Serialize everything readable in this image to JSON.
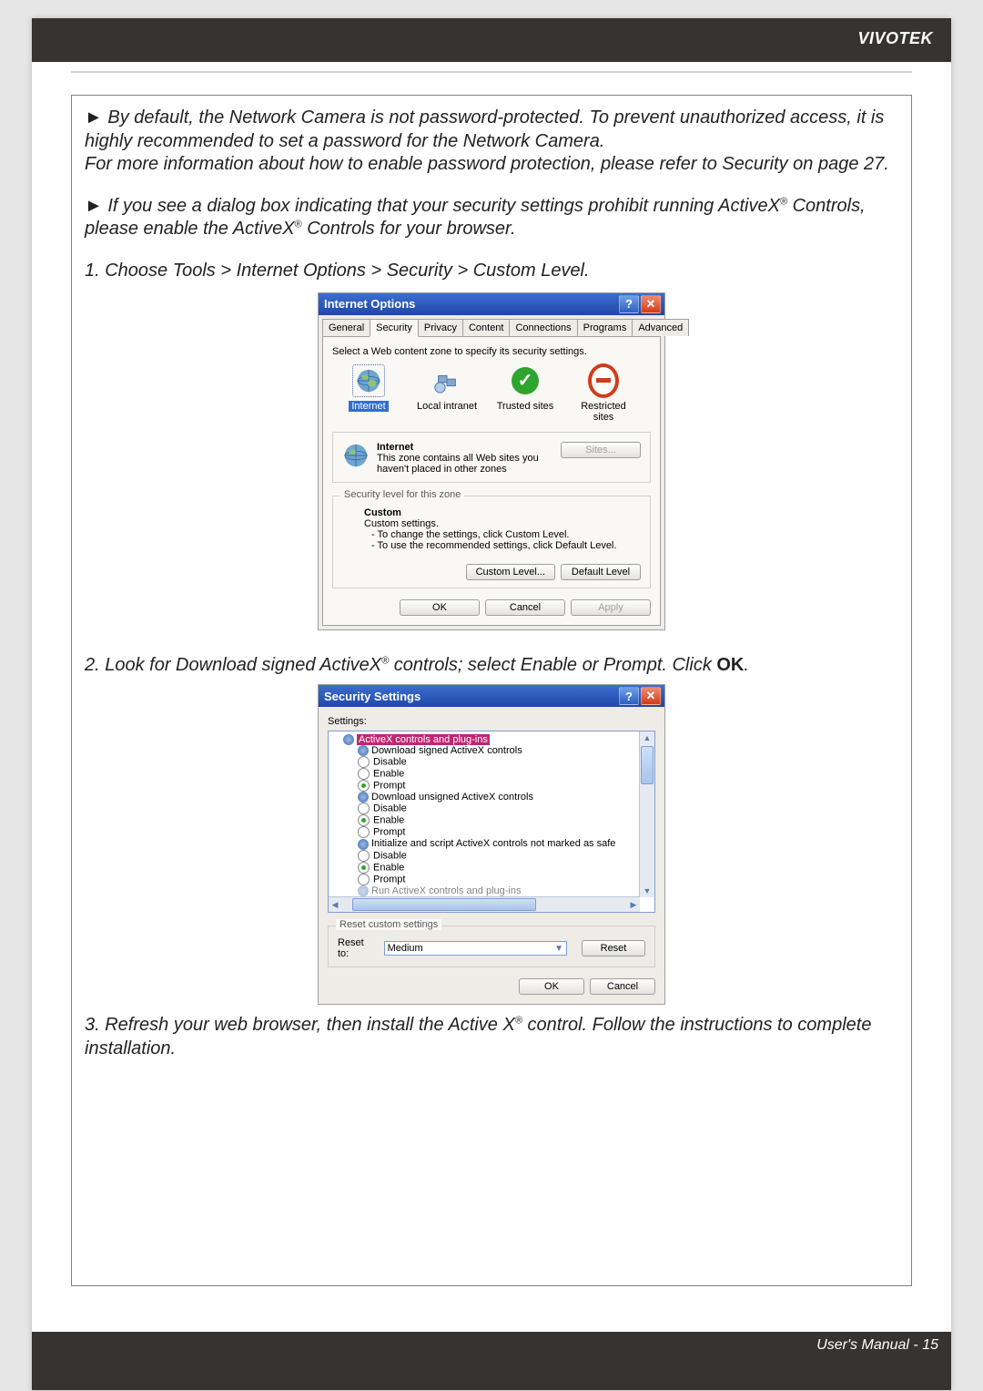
{
  "header": {
    "brand": "VIVOTEK"
  },
  "footer": {
    "text": "User's Manual - 15"
  },
  "paragraphs": {
    "p1a": "By default, the Network Camera is not password-protected. To prevent unauthorized access, it is highly recommended to set a password for the Network Camera.",
    "p1b": "For more information about how to enable password protection, please refer to Security on page 27.",
    "p2_pre": "If you see a dialog box indicating that your security settings prohibit running ActiveX",
    "p2_post": " Controls, please enable the ActiveX",
    "p2_end": " Controls for your browser.",
    "step1": "1. Choose Tools > Internet Options > Security > Custom Level.",
    "step2_pre": "2. Look for Download signed ActiveX",
    "step2_post": " controls; select Enable or Prompt. Click ",
    "step2_ok": "OK",
    "step2_end": ".",
    "step3_pre": "3. Refresh your web browser, then install the Active X",
    "step3_post": " control. Follow the instructions to complete installation."
  },
  "dialog_internet_options": {
    "title": "Internet Options",
    "tabs": [
      "General",
      "Security",
      "Privacy",
      "Content",
      "Connections",
      "Programs",
      "Advanced"
    ],
    "selected_tab": "Security",
    "intro": "Select a Web content zone to specify its security settings.",
    "zones": {
      "internet": "Internet",
      "local": "Local intranet",
      "trusted": "Trusted sites",
      "restricted": "Restricted sites"
    },
    "zone_info_title": "Internet",
    "zone_info_desc": "This zone contains all Web sites you haven't placed in other zones",
    "sites_btn": "Sites...",
    "fieldset_label": "Security level for this zone",
    "custom_title": "Custom",
    "custom_sub": "Custom settings.",
    "custom_line1": "- To change the settings, click Custom Level.",
    "custom_line2": "- To use the recommended settings, click Default Level.",
    "btn_custom": "Custom Level...",
    "btn_default": "Default Level",
    "btn_ok": "OK",
    "btn_cancel": "Cancel",
    "btn_apply": "Apply"
  },
  "dialog_security_settings": {
    "title": "Security Settings",
    "settings_label": "Settings:",
    "tree": {
      "group": "ActiveX controls and plug-ins",
      "item1": "Download signed ActiveX controls",
      "item2": "Download unsigned ActiveX controls",
      "item3": "Initialize and script ActiveX controls not marked as safe",
      "item4_partial": "Run ActiveX controls and plug-ins",
      "opt_disable": "Disable",
      "opt_enable": "Enable",
      "opt_prompt": "Prompt"
    },
    "reset_fieldset": "Reset custom settings",
    "reset_label": "Reset to:",
    "reset_value": "Medium",
    "btn_reset": "Reset",
    "btn_ok": "OK",
    "btn_cancel": "Cancel"
  }
}
